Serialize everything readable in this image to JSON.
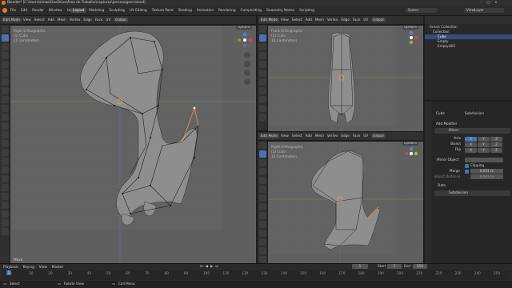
{
  "window": {
    "title": "Blender* [C:\\Users\\simao\\OneDrive\\Área de Trabalho\\capturas\\personagem.blend]"
  },
  "menubar": {
    "menus": [
      "File",
      "Edit",
      "Render",
      "Window",
      "Help"
    ],
    "workspaces": [
      "Layout",
      "Modeling",
      "Sculpting",
      "UV Editing",
      "Texture Paint",
      "Shading",
      "Animation",
      "Rendering",
      "Compositing",
      "Geometry Nodes",
      "Scripting"
    ],
    "active_workspace": "Layout",
    "scene": "Scene",
    "view_layer": "ViewLayer"
  },
  "viewport_main": {
    "mode": "Edit Mode",
    "menus": [
      "View",
      "Select",
      "Add",
      "Mesh",
      "Vertex",
      "Edge",
      "Face",
      "UV"
    ],
    "transform": "Global",
    "overlay": [
      "Right Orthographic",
      "(1) Cube",
      "10 Centimeters"
    ],
    "options": "Options"
  },
  "viewport_front": {
    "mode": "Edit Mode",
    "menus": [
      "View",
      "Select",
      "Add",
      "Mesh",
      "Vertex",
      "Edge",
      "Face",
      "UV"
    ],
    "transform": "Global",
    "overlay": [
      "Front Orthographic",
      "(1) Cube",
      "10 Centimeters"
    ],
    "options": "Options"
  },
  "viewport_right": {
    "mode": "Edit Mode",
    "menus": [
      "View",
      "Select",
      "Add",
      "Mesh",
      "Vertex",
      "Edge",
      "Face",
      "UV"
    ],
    "transform": "Global",
    "overlay": [
      "Right Orthographic",
      "(1) Cube",
      "10 Centimeters"
    ],
    "options": "Options"
  },
  "outliner": {
    "items": [
      {
        "label": "Scene Collection"
      },
      {
        "label": "Collection"
      },
      {
        "label": "Cube"
      },
      {
        "label": "Empty"
      },
      {
        "label": "Empty.001"
      }
    ]
  },
  "properties": {
    "object": "Cube",
    "modifier_name": "Subdivision",
    "add_modifier": "Add Modifier",
    "mirror_label": "Mirror",
    "axis_label": "Axis",
    "bisect_label": "Bisect",
    "flip_label": "Flip",
    "axes": [
      "X",
      "Y",
      "Z"
    ],
    "mirror_object_label": "Mirror Object",
    "clipping_label": "Clipping",
    "merge_label": "Merge",
    "merge_value": "0.001 m",
    "bisect_distance_label": "Bisect Distance",
    "bisect_distance_value": "0.001 m",
    "data_label": "Data",
    "subdivision_label": "Subdivision"
  },
  "timeline": {
    "menus": [
      "Playback",
      "Keying",
      "View",
      "Marker"
    ],
    "frame_current": "1",
    "start_label": "Start",
    "start_value": "1",
    "end_label": "End",
    "end_value": "250",
    "ticks": [
      "0",
      "10",
      "20",
      "30",
      "40",
      "50",
      "60",
      "70",
      "80",
      "90",
      "100",
      "110",
      "120",
      "130",
      "140",
      "150",
      "160",
      "170",
      "180",
      "190",
      "200",
      "210",
      "220",
      "230",
      "240",
      "250"
    ]
  },
  "last_op": "Move",
  "status": {
    "select": "Select",
    "rotate": "Rotate View",
    "call_menu": "Call Menu"
  },
  "colors": {
    "accent": "#4772b3",
    "viewport_bg": "#5f5f5f",
    "grid_line": "#6a6a6a"
  }
}
